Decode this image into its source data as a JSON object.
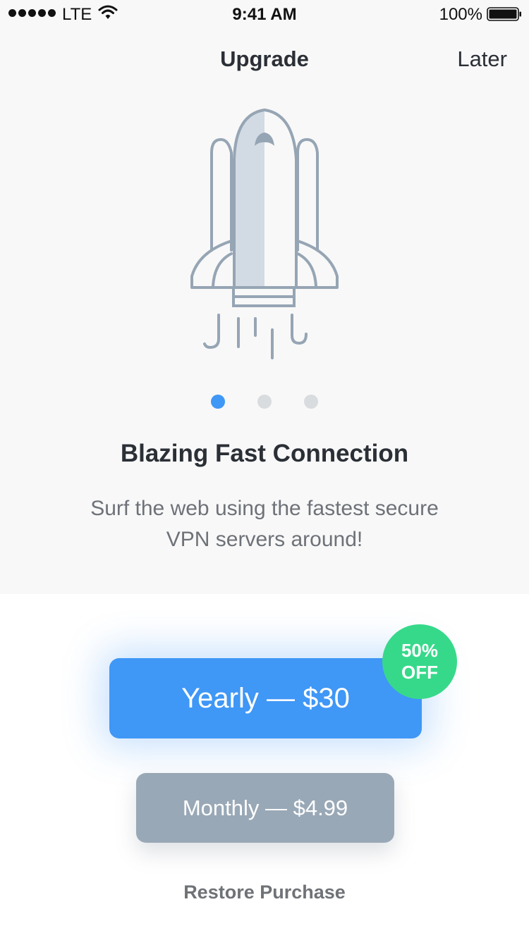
{
  "status_bar": {
    "carrier": "LTE",
    "time": "9:41 AM",
    "battery": "100%",
    "icons": [
      "signal-dots-icon",
      "wifi-icon",
      "battery-icon"
    ]
  },
  "nav": {
    "title": "Upgrade",
    "later_label": "Later"
  },
  "illustration": {
    "icon": "rocket-icon",
    "stroke_color": "#96a5b4",
    "fill_color": "#d2dbe3"
  },
  "pager": {
    "count": 3,
    "active_index": 0,
    "active_color": "#3f97f6",
    "inactive_color": "#d9dcdf"
  },
  "feature": {
    "headline": "Blazing Fast Connection",
    "subtitle": "Surf the web using the fastest secure VPN servers around!"
  },
  "plans": {
    "yearly_label": "Yearly — $30",
    "badge_line1": "50%",
    "badge_line2": "OFF",
    "monthly_label": "Monthly — $4.99"
  },
  "footer": {
    "restore_label": "Restore Purchase"
  },
  "colors": {
    "accent": "#3f97f6",
    "badge": "#36d98a",
    "secondary_button": "#99a8b6",
    "top_background": "#f8f8f8"
  }
}
